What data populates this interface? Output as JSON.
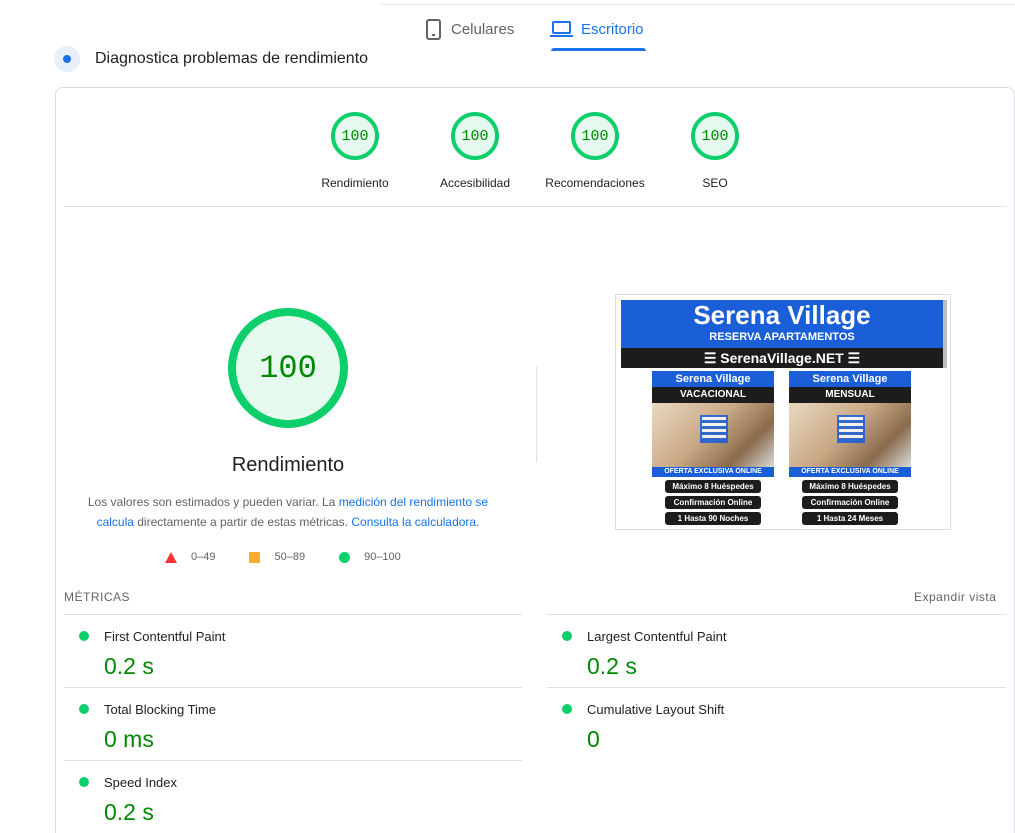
{
  "tabs": {
    "mobile_label": "Celulares",
    "desktop_label": "Escritorio"
  },
  "diagnose": {
    "title": "Diagnostica problemas de rendimiento"
  },
  "categories": [
    {
      "score": "100",
      "label": "Rendimiento"
    },
    {
      "score": "100",
      "label": "Accesibilidad"
    },
    {
      "score": "100",
      "label": "Recomendaciones"
    },
    {
      "score": "100",
      "label": "SEO"
    }
  ],
  "performance": {
    "score": "100",
    "label": "Rendimiento",
    "note_prefix": "Los valores son estimados y pueden variar. La ",
    "note_link1": "medición del rendimiento se calcula",
    "note_middle": " directamente a partir de estas métricas. ",
    "note_link2": "Consulta la calculadora.",
    "legend": {
      "fail": "0–49",
      "average": "50–89",
      "pass": "90–100"
    }
  },
  "thumbnail": {
    "title": "Serena Village",
    "subtitle": "RESERVA APARTAMENTOS",
    "bar": "☰ SerenaVillage.NET ☰",
    "panels": [
      {
        "head": "Serena Village",
        "type": "VACACIONAL",
        "offer": "OFERTA EXCLUSIVA ONLINE",
        "pill1": "Máximo 8 Huéspedes",
        "pill2": "Confirmación Online",
        "pill3": "1 Hasta 90 Noches"
      },
      {
        "head": "Serena Village",
        "type": "MENSUAL",
        "offer": "OFERTA EXCLUSIVA ONLINE",
        "pill1": "Máximo 8 Huéspedes",
        "pill2": "Confirmación Online",
        "pill3": "1 Hasta 24 Meses"
      }
    ]
  },
  "metrics": {
    "heading": "MÉTRICAS",
    "expand_label": "Expandir vista",
    "items": [
      {
        "name": "First Contentful Paint",
        "value": "0.2 s"
      },
      {
        "name": "Largest Contentful Paint",
        "value": "0.2 s"
      },
      {
        "name": "Total Blocking Time",
        "value": "0 ms"
      },
      {
        "name": "Cumulative Layout Shift",
        "value": "0"
      },
      {
        "name": "Speed Index",
        "value": "0.2 s"
      }
    ]
  },
  "colors": {
    "pass": "#0cce6b",
    "average": "#ffaa33",
    "fail": "#ff3333",
    "accent": "#1a73e8"
  },
  "icons": {
    "mobile": "smartphone-icon",
    "desktop": "laptop-icon",
    "diagnose": "diagnose-icon"
  }
}
